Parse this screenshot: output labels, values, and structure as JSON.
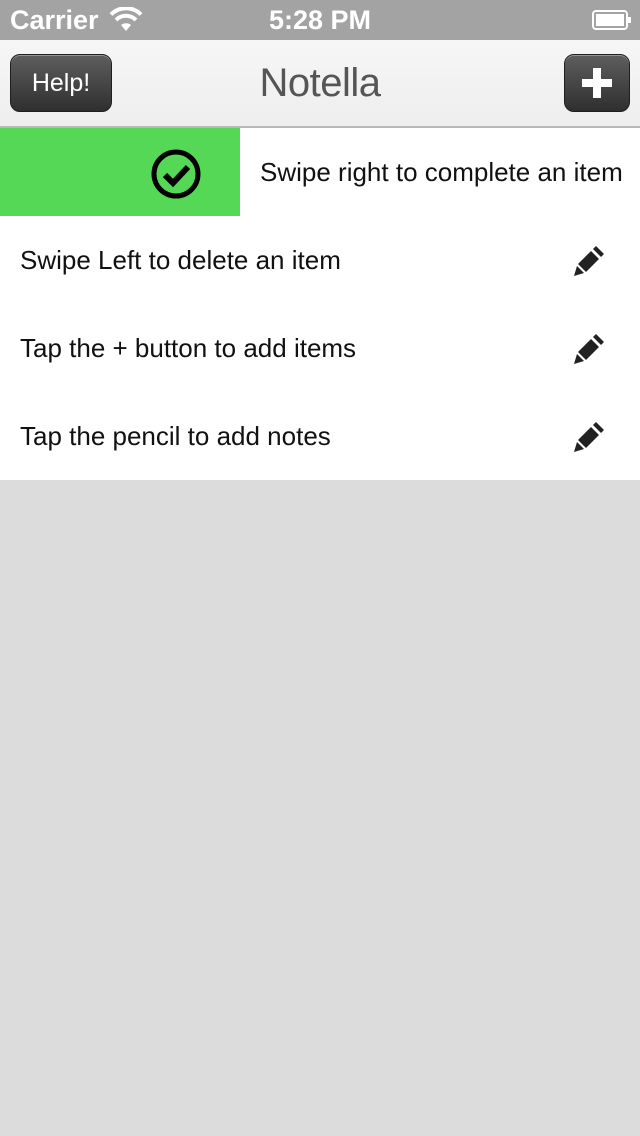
{
  "status_bar": {
    "carrier": "Carrier",
    "time": "5:28 PM",
    "wifi_icon": "wifi-icon",
    "battery_icon": "battery-icon"
  },
  "nav": {
    "help_label": "Help!",
    "title": "Notella",
    "add_icon": "plus-icon"
  },
  "items": [
    {
      "text": "Swipe right to complete an item",
      "state": "swiping-complete"
    },
    {
      "text": "Swipe Left to delete an item",
      "icon": "pencil-icon"
    },
    {
      "text": "Tap the + button to add items",
      "icon": "pencil-icon"
    },
    {
      "text": "Tap the pencil to add notes",
      "icon": "pencil-icon"
    }
  ],
  "colors": {
    "complete_green": "#55d855",
    "nav_button": "#3a3a3a",
    "background": "#dcdcdc"
  }
}
